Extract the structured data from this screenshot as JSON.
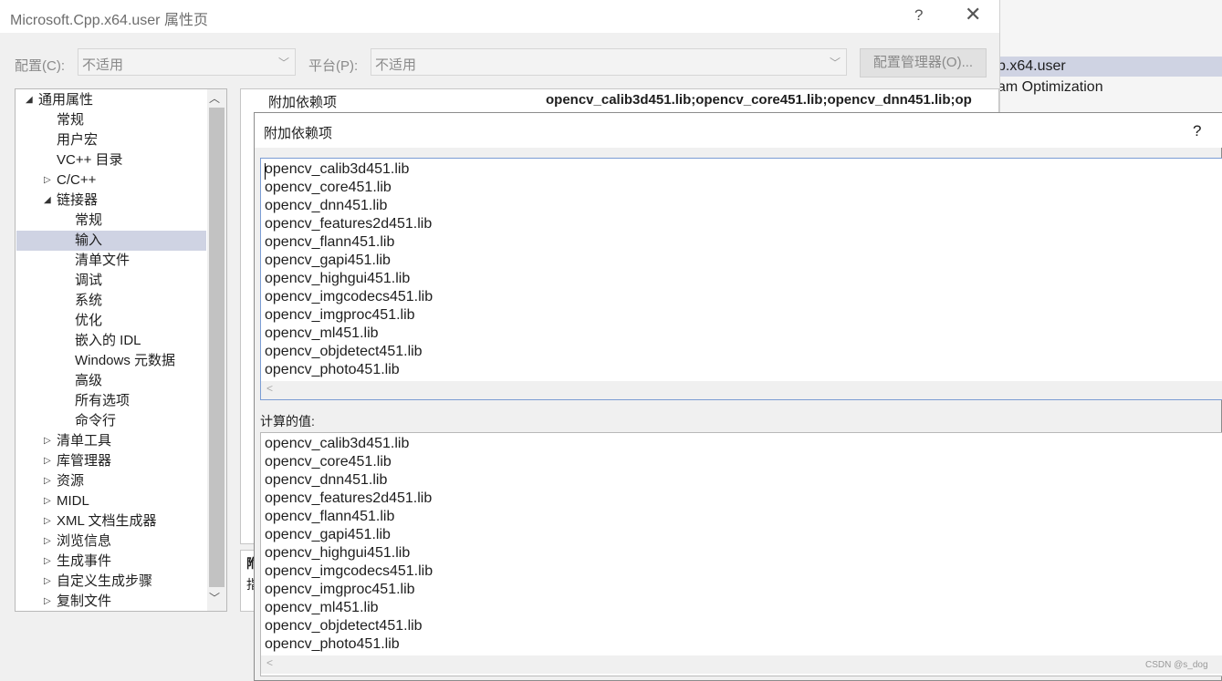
{
  "window": {
    "title": "Microsoft.Cpp.x64.user 属性页",
    "help": "?",
    "close": "✕"
  },
  "config": {
    "config_label": "配置(C):",
    "config_value": "不适用",
    "platform_label": "平台(P):",
    "platform_value": "不适用",
    "manager_button": "配置管理器(O)..."
  },
  "background": {
    "row1": "p.x64.user",
    "row2": "am Optimization"
  },
  "tree": {
    "items": [
      {
        "label": "通用属性",
        "indent": 0,
        "tri": "◢"
      },
      {
        "label": "常规",
        "indent": 1,
        "tri": ""
      },
      {
        "label": "用户宏",
        "indent": 1,
        "tri": ""
      },
      {
        "label": "VC++ 目录",
        "indent": 1,
        "tri": ""
      },
      {
        "label": "C/C++",
        "indent": 1,
        "tri": "▷"
      },
      {
        "label": "链接器",
        "indent": 1,
        "tri": "◢"
      },
      {
        "label": "常规",
        "indent": 2,
        "tri": ""
      },
      {
        "label": "输入",
        "indent": 2,
        "tri": "",
        "selected": true
      },
      {
        "label": "清单文件",
        "indent": 2,
        "tri": ""
      },
      {
        "label": "调试",
        "indent": 2,
        "tri": ""
      },
      {
        "label": "系统",
        "indent": 2,
        "tri": ""
      },
      {
        "label": "优化",
        "indent": 2,
        "tri": ""
      },
      {
        "label": "嵌入的 IDL",
        "indent": 2,
        "tri": ""
      },
      {
        "label": "Windows 元数据",
        "indent": 2,
        "tri": ""
      },
      {
        "label": "高级",
        "indent": 2,
        "tri": ""
      },
      {
        "label": "所有选项",
        "indent": 2,
        "tri": ""
      },
      {
        "label": "命令行",
        "indent": 2,
        "tri": ""
      },
      {
        "label": "清单工具",
        "indent": 1,
        "tri": "▷"
      },
      {
        "label": "库管理器",
        "indent": 1,
        "tri": "▷"
      },
      {
        "label": "资源",
        "indent": 1,
        "tri": "▷"
      },
      {
        "label": "MIDL",
        "indent": 1,
        "tri": "▷"
      },
      {
        "label": "XML 文档生成器",
        "indent": 1,
        "tri": "▷"
      },
      {
        "label": "浏览信息",
        "indent": 1,
        "tri": "▷"
      },
      {
        "label": "生成事件",
        "indent": 1,
        "tri": "▷"
      },
      {
        "label": "自定义生成步骤",
        "indent": 1,
        "tri": "▷"
      },
      {
        "label": "复制文件",
        "indent": 1,
        "tri": "▷"
      }
    ]
  },
  "grid": {
    "prop_name": "附加依赖项",
    "prop_value": "opencv_calib3d451.lib;opencv_core451.lib;opencv_dnn451.lib;op",
    "desc_title": "附",
    "desc_text": "指"
  },
  "dialog": {
    "title": "附加依赖项",
    "help": "?",
    "libs": [
      "opencv_calib3d451.lib",
      "opencv_core451.lib",
      "opencv_dnn451.lib",
      "opencv_features2d451.lib",
      "opencv_flann451.lib",
      "opencv_gapi451.lib",
      "opencv_highgui451.lib",
      "opencv_imgcodecs451.lib",
      "opencv_imgproc451.lib",
      "opencv_ml451.lib",
      "opencv_objdetect451.lib",
      "opencv_photo451.lib"
    ],
    "computed_label": "计算的值:",
    "computed": [
      "opencv_calib3d451.lib",
      "opencv_core451.lib",
      "opencv_dnn451.lib",
      "opencv_features2d451.lib",
      "opencv_flann451.lib",
      "opencv_gapi451.lib",
      "opencv_highgui451.lib",
      "opencv_imgcodecs451.lib",
      "opencv_imgproc451.lib",
      "opencv_ml451.lib",
      "opencv_objdetect451.lib",
      "opencv_photo451.lib"
    ]
  },
  "watermark": "CSDN @s_dog"
}
